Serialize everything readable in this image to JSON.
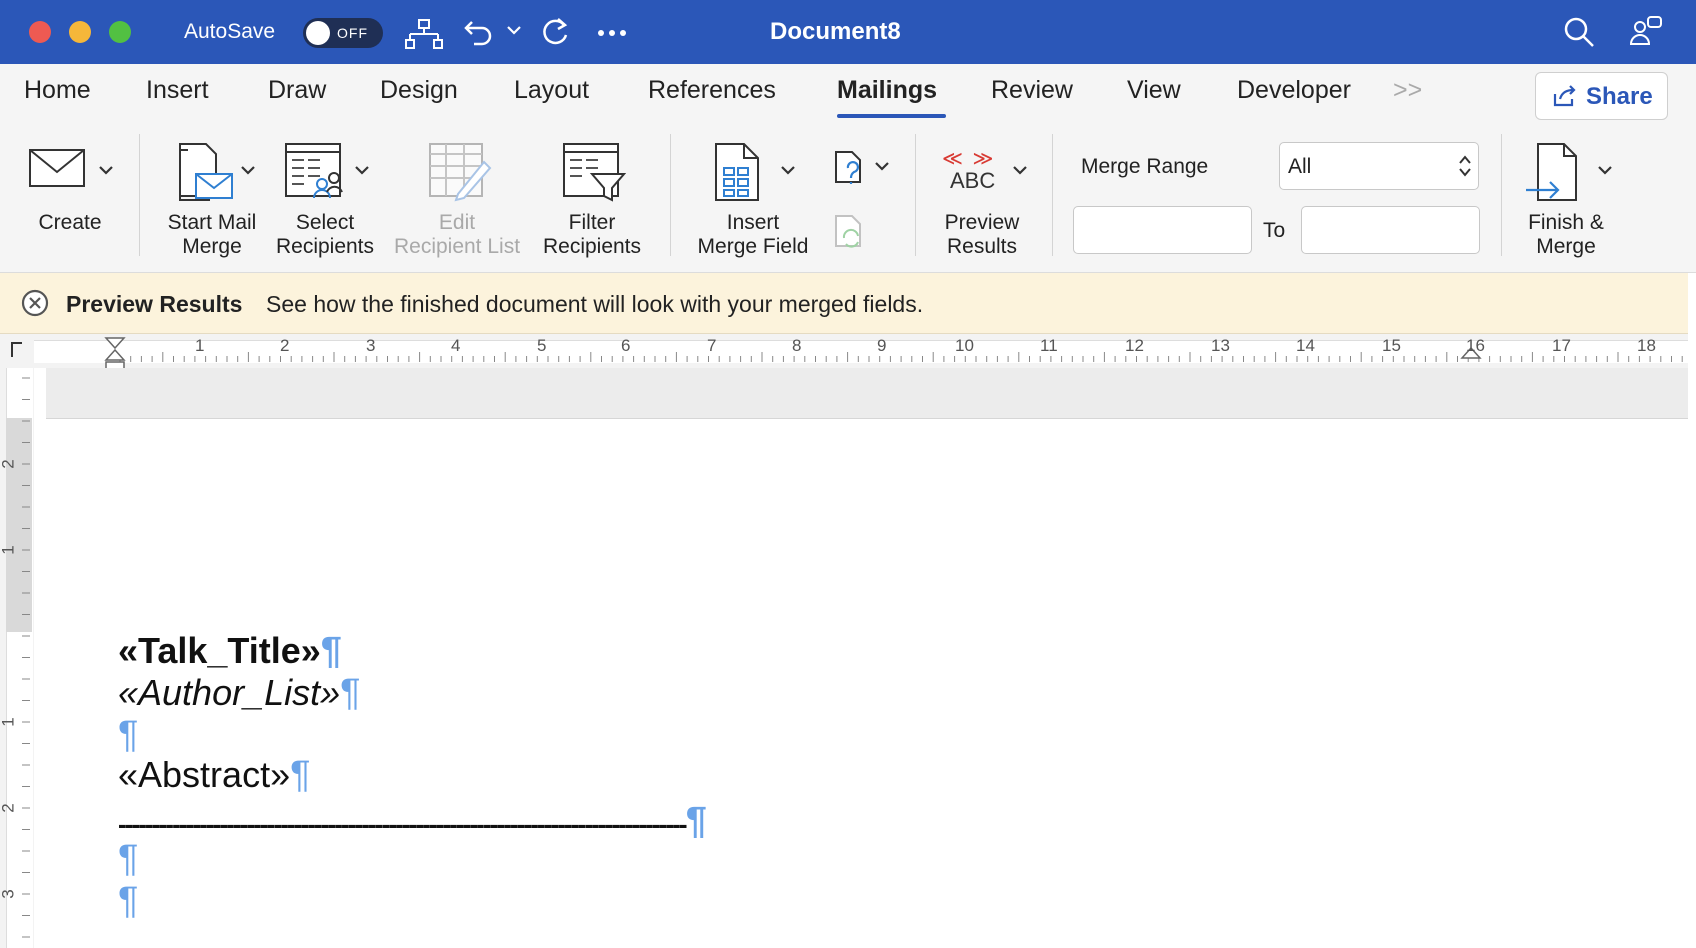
{
  "titlebar": {
    "autosave_label": "AutoSave",
    "autosave_state": "OFF",
    "document_title": "Document8",
    "icons": [
      "sitemap-icon",
      "undo-icon",
      "redo-icon",
      "more-icon",
      "search-icon",
      "collab-icon"
    ]
  },
  "tabs": [
    {
      "label": "Home"
    },
    {
      "label": "Insert"
    },
    {
      "label": "Draw"
    },
    {
      "label": "Design"
    },
    {
      "label": "Layout"
    },
    {
      "label": "References"
    },
    {
      "label": "Mailings",
      "active": true
    },
    {
      "label": "Review"
    },
    {
      "label": "View"
    },
    {
      "label": "Developer"
    }
  ],
  "tabs_overflow": ">>",
  "share_label": "Share",
  "ribbon": {
    "create": "Create",
    "start_mail_merge_1": "Start Mail",
    "start_mail_merge_2": "Merge",
    "select_recipients_1": "Select",
    "select_recipients_2": "Recipients",
    "edit_recipient_list_1": "Edit",
    "edit_recipient_list_2": "Recipient List",
    "filter_recipients_1": "Filter",
    "filter_recipients_2": "Recipients",
    "insert_merge_field_1": "Insert",
    "insert_merge_field_2": "Merge Field",
    "preview_abc": "ABC",
    "preview_chevrons": "≪ ≫",
    "preview_results_1": "Preview",
    "preview_results_2": "Results",
    "merge_range_label": "Merge Range",
    "merge_range_value": "All",
    "from_value": "",
    "to_label": "To",
    "to_value": "",
    "finish_merge_1": "Finish &",
    "finish_merge_2": "Merge"
  },
  "message_bar": {
    "title": "Preview Results",
    "text": "See how the finished document will look with your merged fields."
  },
  "ruler": {
    "h_numbers": [
      "1",
      "2",
      "3",
      "4",
      "5",
      "6",
      "7",
      "8",
      "9",
      "10",
      "11",
      "12",
      "13",
      "14",
      "15",
      "16",
      "17",
      "18"
    ],
    "v_numbers": [
      "2",
      "1",
      "1",
      "2",
      "3"
    ]
  },
  "document": {
    "talk_title": "«Talk_Title»",
    "author_list": "«Author_List»",
    "abstract": "«Abstract»",
    "divider": "------------------------------------------------------------------------------------",
    "pilcrow": "¶"
  },
  "colors": {
    "titlebar": "#2b57b8",
    "accent": "#2b57b8",
    "message_bar": "#fcf3dc",
    "pilcrow": "#6aa3e8"
  }
}
